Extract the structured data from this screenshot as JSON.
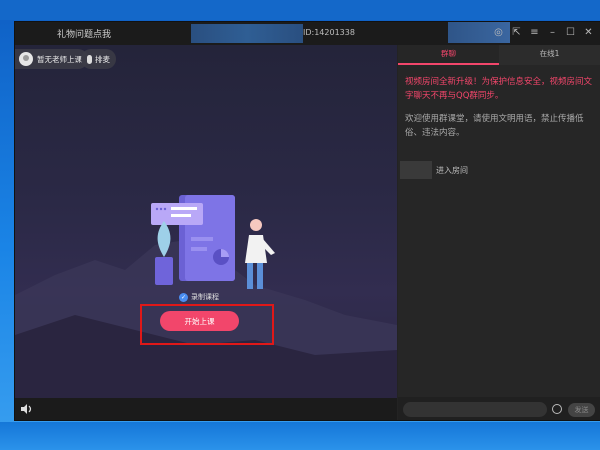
{
  "window": {
    "title": "礼物问题点我",
    "room_id": "ID:14201338",
    "controls": [
      "◎",
      "⇱",
      "≡",
      "–",
      "☐",
      "✕"
    ]
  },
  "stage": {
    "teacher_label": "暂无老师上课",
    "mic_label": "排麦",
    "record_label": "录制课程",
    "start_button": "开始上课"
  },
  "sidebar": {
    "tabs": [
      {
        "label": "群聊",
        "active": true
      },
      {
        "label": "在线1",
        "active": false
      }
    ],
    "notice": "视频房间全新升级！为保护信息安全，视频房间文字聊天不再与QQ群同步。",
    "welcome": "欢迎使用群课堂，请使用文明用语，禁止传播低俗、违法内容。",
    "enter_msg": "进入房间",
    "send_button": "发送"
  },
  "colors": {
    "accent": "#f2466b",
    "highlight": "#e01818"
  }
}
